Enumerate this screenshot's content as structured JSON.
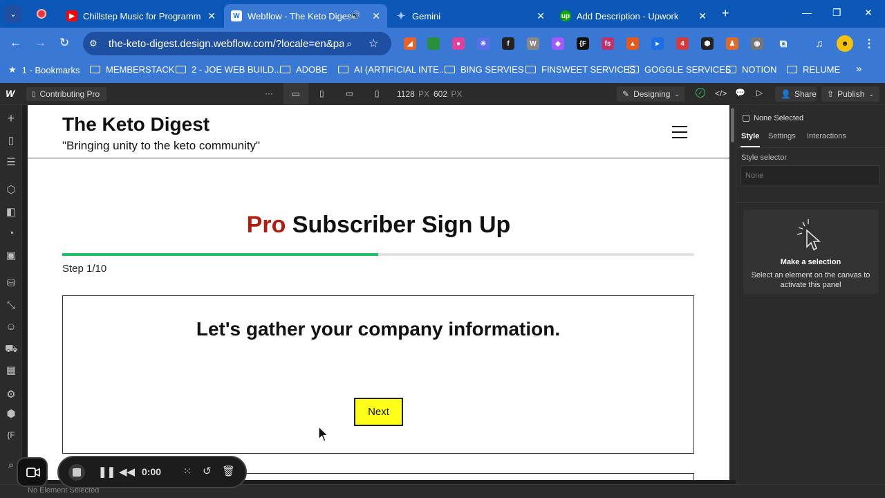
{
  "browser": {
    "tabs": [
      {
        "title": "Chillstep Music for Programmin",
        "active": false
      },
      {
        "title": "Webflow - The Keto Digest",
        "active": true
      },
      {
        "title": "Gemini",
        "active": false
      },
      {
        "title": "Add Description - Upwork",
        "active": false
      }
    ],
    "url": "the-keto-digest.design.webflow.com/?locale=en&pa...",
    "bookmarks": [
      "1 - Bookmarks",
      "MEMBERSTACK",
      "2 - JOE WEB BUILD...",
      "ADOBE",
      "AI (ARTIFICIAL INTE...",
      "BING SERVIES",
      "FINSWEET SERVICES",
      "GOGGLE SERVICES",
      "NOTION",
      "RELUME"
    ],
    "colors": {
      "chrome_blue": "#0b57b7",
      "toolbar_blue": "#3a78d6"
    }
  },
  "webflow": {
    "page_name": "Contributing Pro",
    "width_value": "1128",
    "width_unit": "PX",
    "height_value": "602",
    "height_unit": "PX",
    "mode_label": "Designing",
    "share_label": "Share",
    "publish_label": "Publish",
    "panel": {
      "none_selected": "None Selected",
      "tabs": [
        "Style",
        "Settings",
        "Interactions"
      ],
      "style_selector_label": "Style selector",
      "style_selector_placeholder": "None",
      "empty_title": "Make a selection",
      "empty_text": "Select an element on the canvas to activate this panel"
    },
    "status": "No Element Selected"
  },
  "site": {
    "title": "The Keto Digest",
    "tagline": "\"Bringing unity to the keto community\"",
    "headline_accent": "Pro",
    "headline_rest": " Subscriber Sign Up",
    "step_label": "Step 1/10",
    "progress_fraction": 0.5,
    "question": "Let's gather your company information.",
    "next_label": "Next",
    "colors": {
      "accent_red": "#b01e12",
      "progress_green": "#1fbf6a",
      "button_yellow": "#ffff1a"
    }
  },
  "recorder": {
    "time": "0:00"
  }
}
